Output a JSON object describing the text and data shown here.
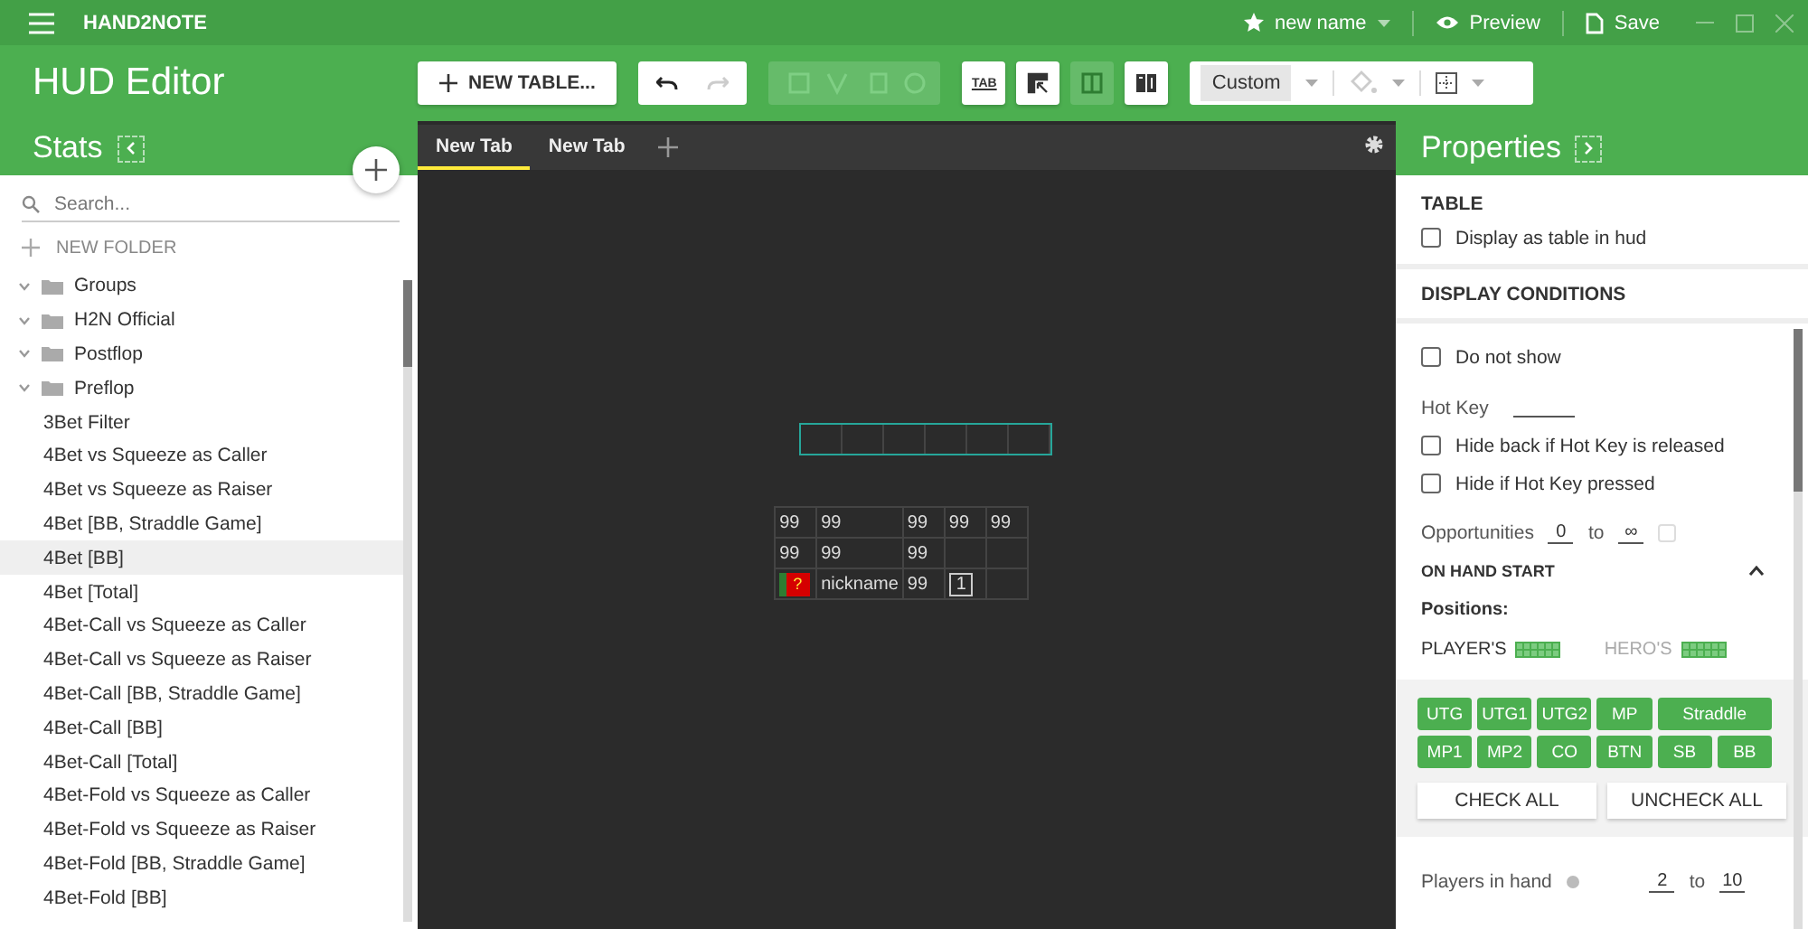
{
  "app_bar": {
    "title": "HAND2NOTE",
    "hud_name": "new name",
    "actions": [
      {
        "kind": "preview",
        "label": "Preview"
      },
      {
        "kind": "save",
        "label": "Save"
      }
    ]
  },
  "header": {
    "title": "HUD Editor"
  },
  "toolbar": {
    "new_table": "NEW TABLE...",
    "redo_disabled": true,
    "tools": [
      {
        "kind": "tab",
        "label": "TAB",
        "selected": false
      },
      {
        "kind": "pick",
        "selected": false
      },
      {
        "kind": "columns",
        "selected": true
      },
      {
        "kind": "split",
        "selected": false
      }
    ],
    "style_preset": "Custom"
  },
  "stats_panel": {
    "title": "Stats",
    "search": {
      "placeholder": "Search..."
    },
    "new_folder": "NEW FOLDER",
    "items": [
      {
        "kind": "folder",
        "label": "Groups",
        "selected": false
      },
      {
        "kind": "folder",
        "label": "H2N Official",
        "selected": false
      },
      {
        "kind": "folder",
        "label": "Postflop",
        "selected": false
      },
      {
        "kind": "folder",
        "label": "Preflop",
        "selected": false
      },
      {
        "kind": "stat",
        "label": "3Bet Filter",
        "selected": false
      },
      {
        "kind": "stat",
        "label": "4Bet vs Squeeze as Caller",
        "selected": false
      },
      {
        "kind": "stat",
        "label": "4Bet vs Squeeze as Raiser",
        "selected": false
      },
      {
        "kind": "stat",
        "label": "4Bet [BB, Straddle Game]",
        "selected": false
      },
      {
        "kind": "stat",
        "label": "4Bet [BB]",
        "selected": true
      },
      {
        "kind": "stat",
        "label": "4Bet [Total]",
        "selected": false
      },
      {
        "kind": "stat",
        "label": "4Bet-Call vs Squeeze as Caller",
        "selected": false
      },
      {
        "kind": "stat",
        "label": "4Bet-Call vs Squeeze as Raiser",
        "selected": false
      },
      {
        "kind": "stat",
        "label": "4Bet-Call [BB, Straddle Game]",
        "selected": false
      },
      {
        "kind": "stat",
        "label": "4Bet-Call [BB]",
        "selected": false
      },
      {
        "kind": "stat",
        "label": "4Bet-Call [Total]",
        "selected": false
      },
      {
        "kind": "stat",
        "label": "4Bet-Fold vs Squeeze as Caller",
        "selected": false
      },
      {
        "kind": "stat",
        "label": "4Bet-Fold vs Squeeze as Raiser",
        "selected": false
      },
      {
        "kind": "stat",
        "label": "4Bet-Fold [BB, Straddle Game]",
        "selected": false
      },
      {
        "kind": "stat",
        "label": "4Bet-Fold [BB]",
        "selected": false
      }
    ]
  },
  "tabs": [
    {
      "label": "New Tab",
      "selected": true
    },
    {
      "label": "New Tab",
      "selected": false
    }
  ],
  "hud_table": {
    "rows": [
      [
        {
          "kind": "text",
          "text": "99"
        },
        {
          "kind": "text",
          "text": "99"
        },
        {
          "kind": "text",
          "text": "99"
        },
        {
          "kind": "text",
          "text": "99"
        },
        {
          "kind": "text",
          "text": "99"
        }
      ],
      [
        {
          "kind": "text",
          "text": "99"
        },
        {
          "kind": "text",
          "text": "99"
        },
        {
          "kind": "text",
          "text": "99"
        },
        {
          "kind": "empty"
        },
        {
          "kind": "empty"
        }
      ],
      [
        {
          "kind": "flag",
          "text": "?"
        },
        {
          "kind": "text",
          "text": "nickname"
        },
        {
          "kind": "text",
          "text": "99"
        },
        {
          "kind": "boxed",
          "text": "1"
        },
        {
          "kind": "empty"
        }
      ]
    ]
  },
  "properties": {
    "title": "Properties",
    "table_section": {
      "title": "TABLE",
      "options": [
        {
          "label": "Display as table in hud",
          "checked": false
        }
      ]
    },
    "display_conditions": {
      "title": "DISPLAY CONDITIONS",
      "do_not_show": {
        "label": "Do not show",
        "checked": false
      },
      "hot_key_label": "Hot Key",
      "hot_key_options": [
        {
          "label": "Hide back if Hot Key is released",
          "checked": false
        },
        {
          "label": "Hide if Hot Key pressed",
          "checked": false
        }
      ],
      "opportunities": {
        "label": "Opportunities",
        "from": "0",
        "to_word": "to",
        "to": "∞"
      },
      "on_hand_start": {
        "title": "ON HAND START",
        "expanded": true,
        "positions_label": "Positions:",
        "players": "PLAYER'S",
        "heroes": "HERO'S",
        "positions": [
          {
            "label": "UTG",
            "selected": true
          },
          {
            "label": "UTG1",
            "selected": true
          },
          {
            "label": "UTG2",
            "selected": true
          },
          {
            "label": "MP",
            "selected": true
          },
          {
            "label": "Straddle",
            "selected": true
          },
          {
            "label": "MP1",
            "selected": true
          },
          {
            "label": "MP2",
            "selected": true
          },
          {
            "label": "CO",
            "selected": true
          },
          {
            "label": "BTN",
            "selected": true
          },
          {
            "label": "SB",
            "selected": true
          },
          {
            "label": "BB",
            "selected": true
          }
        ],
        "check_all": "CHECK ALL",
        "uncheck_all": "UNCHECK ALL"
      },
      "players_in_hand": {
        "label": "Players in hand",
        "from": "2",
        "to_word": "to",
        "to": "10"
      }
    }
  }
}
